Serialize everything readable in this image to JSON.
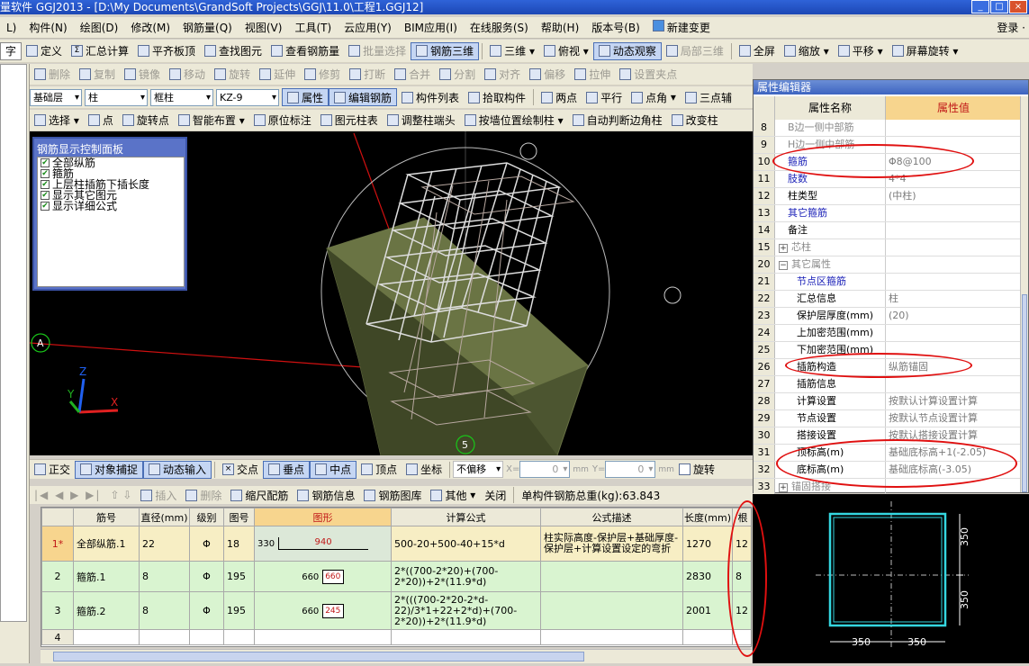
{
  "app": {
    "title": "量软件 GGJ2013 - [D:\\My Documents\\GrandSoft Projects\\GGJ\\11.0\\工程1.GGJ12]",
    "window_buttons": [
      "_",
      "□",
      "×"
    ]
  },
  "menu": {
    "items": [
      "L)",
      "构件(N)",
      "绘图(D)",
      "修改(M)",
      "钢筋量(Q)",
      "视图(V)",
      "工具(T)",
      "云应用(Y)",
      "BIM应用(I)",
      "在线服务(S)",
      "帮助(H)",
      "版本号(B)",
      "新建变更"
    ],
    "login": "登录 ·"
  },
  "toolbar1": {
    "items": [
      "定义",
      "汇总计算",
      "平齐板顶",
      "查找图元",
      "查看钢筋量",
      "批量选择",
      "钢筋三维",
      "三维",
      "俯视",
      "动态观察",
      "局部三维",
      "全屏",
      "缩放",
      "平移",
      "屏幕旋转"
    ],
    "left_tab": "字"
  },
  "toolbar2": {
    "items": [
      "删除",
      "复制",
      "镜像",
      "移动",
      "旋转",
      "延伸",
      "修剪",
      "打断",
      "合并",
      "分割",
      "对齐",
      "偏移",
      "拉伸",
      "设置夹点"
    ]
  },
  "toolbar3": {
    "floor": "基础层",
    "type": "柱",
    "subtype": "框柱",
    "name": "KZ-9",
    "items": [
      "属性",
      "编辑钢筋",
      "构件列表",
      "拾取构件",
      "两点",
      "平行",
      "点角",
      "三点辅"
    ]
  },
  "toolbar4": {
    "items": [
      "选择",
      "点",
      "旋转点",
      "智能布置",
      "原位标注",
      "图元柱表",
      "调整柱端头",
      "按墙位置绘制柱",
      "自动判断边角柱",
      "改变柱"
    ]
  },
  "rebar_panel": {
    "title": "钢筋显示控制面板",
    "options": [
      "全部纵筋",
      "箍筋",
      "上层柱插筋下插长度",
      "显示其它图元",
      "显示详细公式"
    ]
  },
  "viewport": {
    "axis_labels": [
      "A",
      "5"
    ],
    "gizmo": [
      "X",
      "Y",
      "Z"
    ]
  },
  "snap_bar": {
    "items": [
      "正交",
      "对象捕捉",
      "动态输入",
      "交点",
      "垂点",
      "中点",
      "顶点",
      "坐标"
    ],
    "offset_mode": "不偏移",
    "x_label": "X=",
    "x_value": "0",
    "y_label": "Y=",
    "y_value": "0",
    "unit": "mm",
    "rotate": "旋转"
  },
  "grid_toolbar": {
    "items": [
      "插入",
      "删除",
      "缩尺配筋",
      "钢筋信息",
      "钢筋图库",
      "其他",
      "关闭"
    ],
    "total_label": "单构件钢筋总重(kg):63.843"
  },
  "rebar_table": {
    "headers": [
      "",
      "筋号",
      "直径(mm)",
      "级别",
      "图号",
      "图形",
      "计算公式",
      "公式描述",
      "长度(mm)",
      "根"
    ],
    "rows": [
      {
        "idx": "1*",
        "name": "全部纵筋.1",
        "dia": "22",
        "grade": "Φ",
        "fig": "18",
        "shape_l": "330",
        "shape_v": "940",
        "formula": "500-20+500-40+15*d",
        "desc": "柱实际高度-保护层+基础厚度-保护层+计算设置设定的弯折",
        "len": "1270",
        "count": "12"
      },
      {
        "idx": "2",
        "name": "箍筋.1",
        "dia": "8",
        "grade": "Φ",
        "fig": "195",
        "shape_l": "660",
        "shape_v": "660",
        "formula": "2*((700-2*20)+(700-2*20))+2*(11.9*d)",
        "desc": "",
        "len": "2830",
        "count": "8"
      },
      {
        "idx": "3",
        "name": "箍筋.2",
        "dia": "8",
        "grade": "Φ",
        "fig": "195",
        "shape_l": "660",
        "shape_v": "245",
        "formula": "2*(((700-2*20-2*d-22)/3*1+22+2*d)+(700-2*20))+2*(11.9*d)",
        "desc": "",
        "len": "2001",
        "count": "12"
      },
      {
        "idx": "4",
        "name": "",
        "dia": "",
        "grade": "",
        "fig": "",
        "shape_l": "",
        "shape_v": "",
        "formula": "",
        "desc": "",
        "len": "",
        "count": ""
      }
    ]
  },
  "property_editor": {
    "title": "属性编辑器",
    "col_name": "属性名称",
    "col_value": "属性值",
    "rows": [
      {
        "n": "8",
        "k": "B边一侧中部筋",
        "v": "",
        "style": "gray",
        "indent": 1
      },
      {
        "n": "9",
        "k": "H边一侧中部筋",
        "v": "",
        "style": "gray",
        "indent": 1
      },
      {
        "n": "10",
        "k": "箍筋",
        "v": "Φ8@100",
        "style": "blue",
        "indent": 1
      },
      {
        "n": "11",
        "k": "肢数",
        "v": "4*4",
        "style": "blue",
        "indent": 1
      },
      {
        "n": "12",
        "k": "柱类型",
        "v": "(中柱)",
        "style": "",
        "indent": 1
      },
      {
        "n": "13",
        "k": "其它箍筋",
        "v": "",
        "style": "blue",
        "indent": 1
      },
      {
        "n": "14",
        "k": "备注",
        "v": "",
        "style": "",
        "indent": 1
      },
      {
        "n": "15",
        "k": "芯柱",
        "v": "",
        "style": "gray",
        "indent": 0,
        "expand": "+"
      },
      {
        "n": "20",
        "k": "其它属性",
        "v": "",
        "style": "gray",
        "indent": 0,
        "expand": "−"
      },
      {
        "n": "21",
        "k": "节点区箍筋",
        "v": "",
        "style": "blue",
        "indent": 2
      },
      {
        "n": "22",
        "k": "汇总信息",
        "v": "柱",
        "style": "",
        "indent": 2
      },
      {
        "n": "23",
        "k": "保护层厚度(mm)",
        "v": "(20)",
        "style": "",
        "indent": 2
      },
      {
        "n": "24",
        "k": "上加密范围(mm)",
        "v": "",
        "style": "",
        "indent": 2
      },
      {
        "n": "25",
        "k": "下加密范围(mm)",
        "v": "",
        "style": "",
        "indent": 2
      },
      {
        "n": "26",
        "k": "插筋构造",
        "v": "纵筋锚固",
        "style": "",
        "indent": 2
      },
      {
        "n": "27",
        "k": "插筋信息",
        "v": "",
        "style": "",
        "indent": 2
      },
      {
        "n": "28",
        "k": "计算设置",
        "v": "按默认计算设置计算",
        "style": "",
        "indent": 2
      },
      {
        "n": "29",
        "k": "节点设置",
        "v": "按默认节点设置计算",
        "style": "",
        "indent": 2
      },
      {
        "n": "30",
        "k": "搭接设置",
        "v": "按默认搭接设置计算",
        "style": "",
        "indent": 2
      },
      {
        "n": "31",
        "k": "顶标高(m)",
        "v": "基础底标高+1(-2.05)",
        "style": "",
        "indent": 2
      },
      {
        "n": "32",
        "k": "底标高(m)",
        "v": "基础底标高(-3.05)",
        "style": "",
        "indent": 2
      },
      {
        "n": "33",
        "k": "锚固搭接",
        "v": "",
        "style": "gray",
        "indent": 0,
        "expand": "+"
      }
    ]
  },
  "section_view": {
    "dim_right_top": "350",
    "dim_right_bottom": "350",
    "dim_bottom_left": "350",
    "dim_bottom_right": "350"
  },
  "colors": {
    "highlight_header": "#f7d58e",
    "annotation": "#e01010",
    "row_green": "#d9f4d0"
  }
}
